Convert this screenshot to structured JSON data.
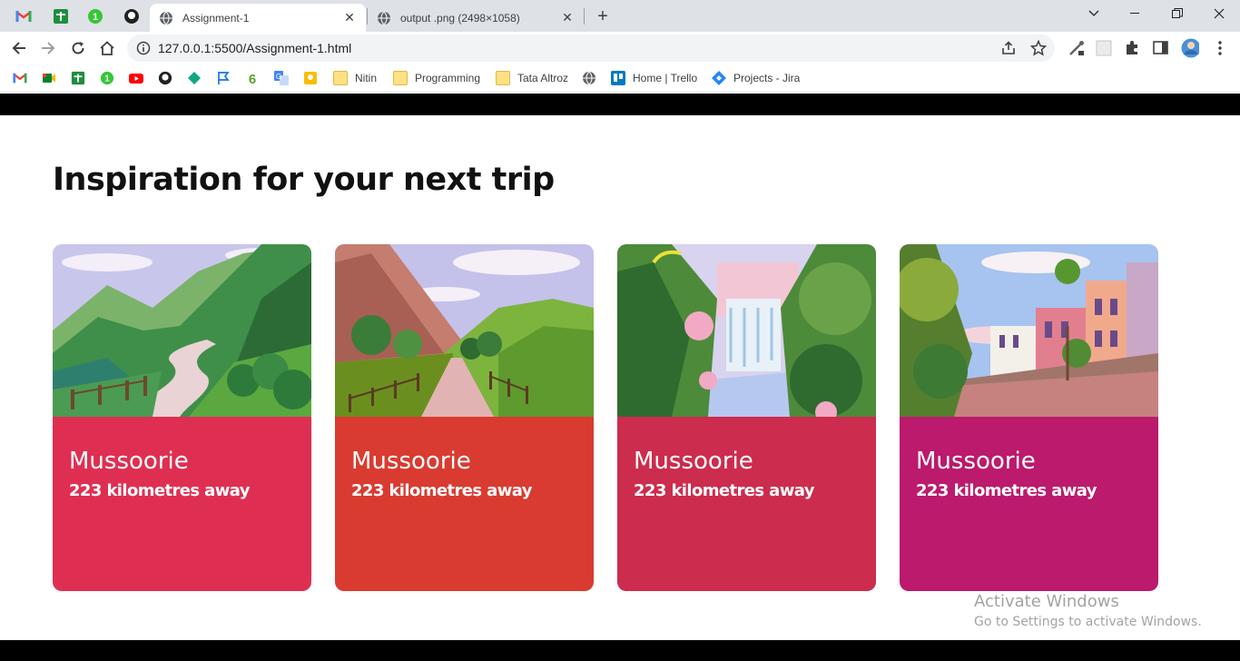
{
  "browser": {
    "tabs": [
      {
        "title": "Assignment-1",
        "active": true
      },
      {
        "title": "output .png (2498×1058)",
        "active": false
      }
    ],
    "url": "127.0.0.1:5500/Assignment-1.html",
    "pinned_icons": [
      "gmail-icon",
      "sheets-icon",
      "counter-icon",
      "github-icon"
    ],
    "bookmarks": [
      {
        "label": "Nitin",
        "icon": "folder-icon"
      },
      {
        "label": "Programming",
        "icon": "folder-icon"
      },
      {
        "label": "Tata Altroz",
        "icon": "folder-icon"
      },
      {
        "label": "Home | Trello",
        "icon": "trello-icon"
      },
      {
        "label": "Projects - Jira",
        "icon": "jira-icon"
      }
    ]
  },
  "page": {
    "heading": "Inspiration for your next trip",
    "cards": [
      {
        "city": "Mussoorie",
        "distance": "223 kilometres away",
        "color": "#de2f52"
      },
      {
        "city": "Mussoorie",
        "distance": "223 kilometres away",
        "color": "#d93b30"
      },
      {
        "city": "Mussoorie",
        "distance": "223 kilometres away",
        "color": "#cc2c4d"
      },
      {
        "city": "Mussoorie",
        "distance": "223 kilometres away",
        "color": "#bb1a6d"
      }
    ]
  },
  "os_watermark": {
    "line1": "Activate Windows",
    "line2": "Go to Settings to activate Windows."
  }
}
